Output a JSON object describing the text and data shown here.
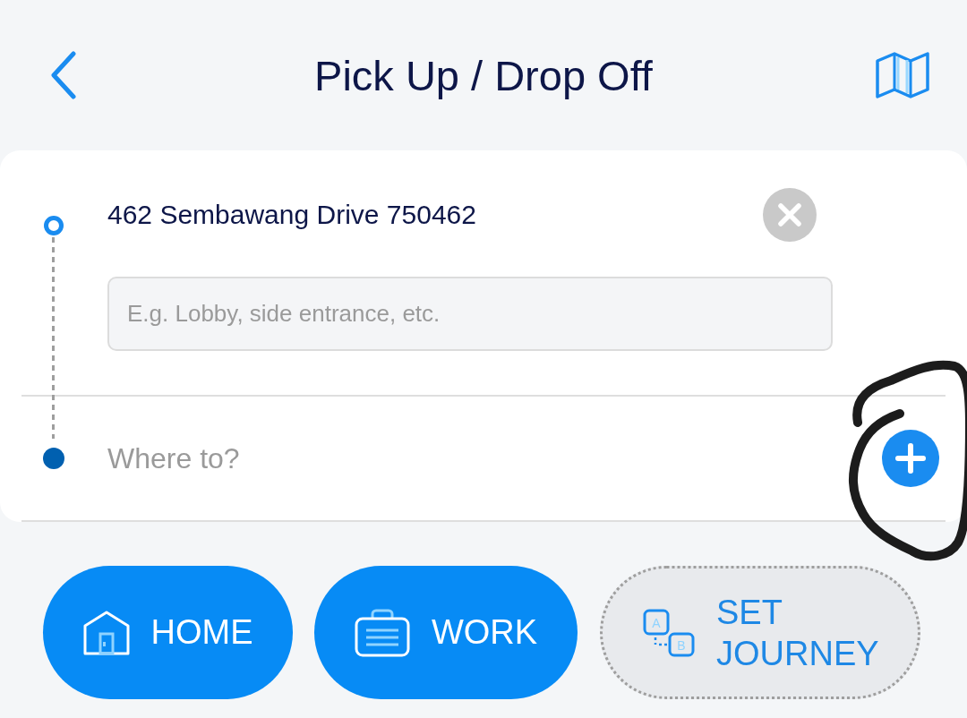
{
  "header": {
    "title": "Pick Up / Drop Off"
  },
  "route": {
    "stops": [
      {
        "kind": "origin",
        "value": "462 Sembawang Drive 750462",
        "note": {
          "placeholder": "E.g. Lobby, side entrance, etc."
        }
      },
      {
        "kind": "destination",
        "placeholder": "Where to?"
      }
    ]
  },
  "shortcuts": [
    {
      "kind": "home",
      "label": "HOME"
    },
    {
      "kind": "work",
      "label": "WORK"
    },
    {
      "kind": "journey",
      "label": "SET JOURNEY",
      "icon_letters": [
        "A",
        "B"
      ]
    }
  ]
}
